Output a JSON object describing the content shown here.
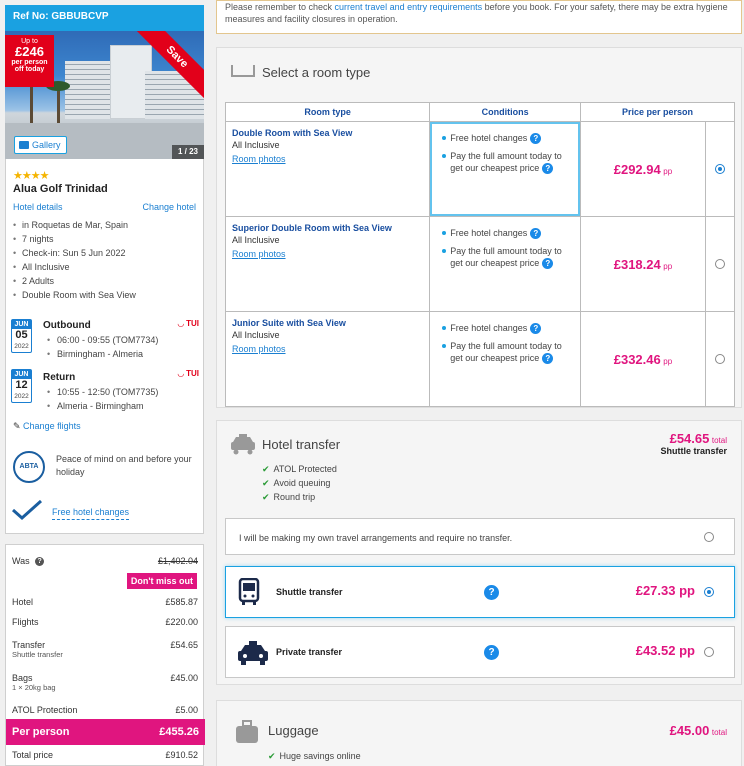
{
  "booking": {
    "ref": "Ref No: GBBUBCVP",
    "image_count": "1 / 23",
    "gallery_label": "Gallery",
    "badge": {
      "top": "Up to",
      "amount": "£246",
      "line1": "per person",
      "line2": "off today"
    },
    "ribbon": "Save"
  },
  "hotel": {
    "stars": "★★★★",
    "name": "Alua Golf Trinidad",
    "details_link": "Hotel details",
    "change_link": "Change hotel",
    "facts": [
      "in Roquetas de Mar, Spain",
      "7 nights",
      "Check-in: Sun 5 Jun 2022",
      "All Inclusive",
      "2 Adults",
      "Double Room with Sea View"
    ]
  },
  "flights": {
    "outbound": {
      "month": "JUN",
      "day": "05",
      "year": "2022",
      "title": "Outbound",
      "airline": "TUI",
      "times": "06:00 - 09:55 (TOM7734)",
      "route": "Birmingham - Almeria"
    },
    "return": {
      "month": "JUN",
      "day": "12",
      "year": "2022",
      "title": "Return",
      "airline": "TUI",
      "times": "10:55 - 12:50 (TOM7735)",
      "route": "Almeria - Birmingham"
    },
    "change_link": "Change flights"
  },
  "protection": {
    "logo_text": "ABTA",
    "text": "Peace of mind on and before your holiday",
    "free_changes": "Free hotel changes"
  },
  "pricing": {
    "was_label": "Was",
    "was_value": "£1,402.04",
    "dont_miss": "Don't miss out",
    "rows": [
      {
        "label": "Hotel",
        "value": "£585.87",
        "sub": ""
      },
      {
        "label": "Flights",
        "value": "£220.00",
        "sub": ""
      },
      {
        "label": "Transfer",
        "value": "£54.65",
        "sub": "Shuttle transfer"
      },
      {
        "label": "Bags",
        "value": "£45.00",
        "sub": "1 × 20kg bag"
      },
      {
        "label": "ATOL Protection",
        "value": "£5.00",
        "sub": ""
      }
    ],
    "per_person_label": "Per person",
    "per_person_value": "£455.26",
    "total_label": "Total price",
    "total_value": "£910.52"
  },
  "notice": {
    "pre": "Please remember to check ",
    "link": "current travel and entry requirements",
    "post": " before you book. For your safety, there may be extra hygiene measures and facility closures in operation."
  },
  "rooms": {
    "title": "Select a room type",
    "headers": [
      "Room type",
      "Conditions",
      "Price per person"
    ],
    "items": [
      {
        "name": "Double Room with Sea View",
        "board": "All Inclusive",
        "photos": "Room photos",
        "cond1": "Free hotel changes",
        "cond2": "Pay the full amount today to get our cheapest price",
        "price": "£292.94",
        "unit": "pp",
        "selected": true
      },
      {
        "name": "Superior Double Room with Sea View",
        "board": "All Inclusive",
        "photos": "Room photos",
        "cond1": "Free hotel changes",
        "cond2": "Pay the full amount today to get our cheapest price",
        "price": "£318.24",
        "unit": "pp",
        "selected": false
      },
      {
        "name": "Junior Suite with Sea View",
        "board": "All Inclusive",
        "photos": "Room photos",
        "cond1": "Free hotel changes",
        "cond2": "Pay the full amount today to get our cheapest price",
        "price": "£332.46",
        "unit": "pp",
        "selected": false
      }
    ]
  },
  "transfer": {
    "title": "Hotel transfer",
    "price": "£54.65",
    "total": "total",
    "type": "Shuttle transfer",
    "checks": [
      "ATOL Protected",
      "Avoid queuing",
      "Round trip"
    ],
    "none_label": "I will be making my own travel arrangements and require no transfer.",
    "options": [
      {
        "label": "Shuttle transfer",
        "price": "£27.33",
        "unit": "pp"
      },
      {
        "label": "Private transfer",
        "price": "£43.52",
        "unit": "pp"
      }
    ]
  },
  "luggage": {
    "title": "Luggage",
    "price": "£45.00",
    "total": "total",
    "check": "Huge savings online"
  },
  "colors": {
    "accent": "#1aa1e1",
    "price": "#e0157f",
    "badge": "#e2001a"
  }
}
